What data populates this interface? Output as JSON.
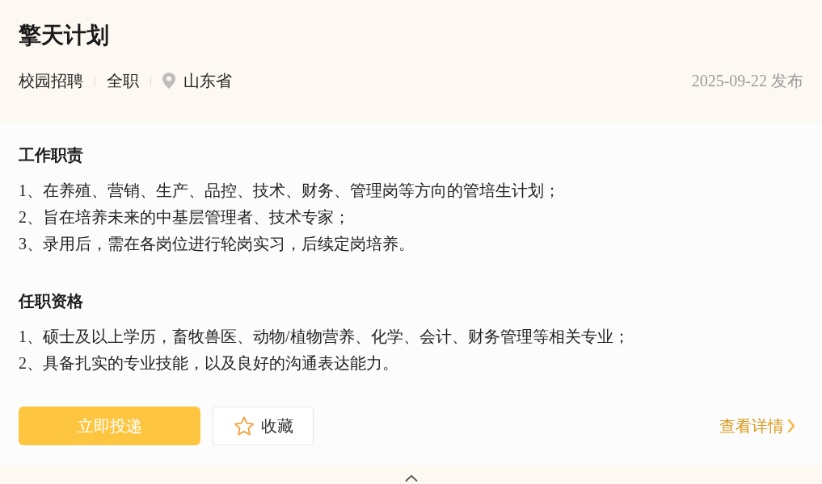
{
  "job": {
    "title": "擎天计划",
    "tags": [
      {
        "kind": "text",
        "label": "校园招聘"
      },
      {
        "kind": "text",
        "label": "全职"
      },
      {
        "kind": "location",
        "label": "山东省"
      }
    ],
    "published": "2025-09-22 发布"
  },
  "sections": [
    {
      "heading": "工作职责",
      "lines": [
        "1、在养殖、营销、生产、品控、技术、财务、管理岗等方向的管培生计划；",
        "2、旨在培养未来的中基层管理者、技术专家；",
        "3、录用后，需在各岗位进行轮岗实习，后续定岗培养。"
      ]
    },
    {
      "heading": "任职资格",
      "lines": [
        "1、硕士及以上学历，畜牧兽医、动物/植物营养、化学、会计、财务管理等相关专业；",
        "2、具备扎实的专业技能，以及良好的沟通表达能力。"
      ]
    }
  ],
  "actions": {
    "apply": "立即投递",
    "favorite": {
      "label": "收藏",
      "favorited": false
    },
    "details": "查看详情"
  }
}
